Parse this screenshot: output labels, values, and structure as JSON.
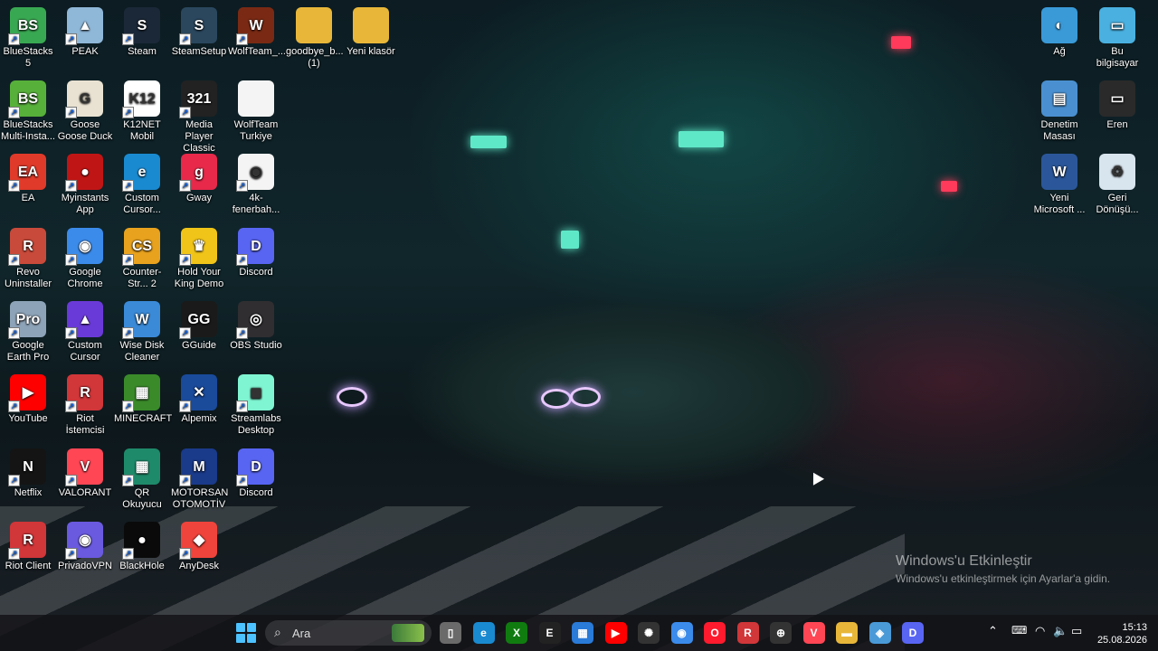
{
  "desktop_icons": [
    {
      "label": "BlueStacks 5",
      "icon": "bluestacks-icon",
      "color": "#39a852",
      "glyph": "BS"
    },
    {
      "label": "PEAK",
      "icon": "peak-icon",
      "color": "#8fb7d8",
      "glyph": "▲"
    },
    {
      "label": "Steam",
      "icon": "steam-icon",
      "color": "#1b2838",
      "glyph": "S"
    },
    {
      "label": "SteamSetup",
      "icon": "steam-setup-icon",
      "color": "#2a475e",
      "glyph": "S"
    },
    {
      "label": "WolfTeam_...",
      "icon": "wolfteam-icon",
      "color": "#7a2a14",
      "glyph": "W"
    },
    {
      "label": "goodbye_b... (1)",
      "icon": "folder-icon",
      "color": "#e8b73a",
      "glyph": ""
    },
    {
      "label": "Yeni klasör",
      "icon": "folder-icon",
      "color": "#e8b73a",
      "glyph": ""
    },
    {
      "label": "BlueStacks Multi-Insta...",
      "icon": "bluestacks-multi-icon",
      "color": "#57b03a",
      "glyph": "BS"
    },
    {
      "label": "Goose Goose Duck",
      "icon": "goose-icon",
      "color": "#e9e2d2",
      "glyph": "G"
    },
    {
      "label": "K12NET Mobil",
      "icon": "k12net-icon",
      "color": "#ffffff",
      "glyph": "K12"
    },
    {
      "label": "Media Player Classic",
      "icon": "media-player-icon",
      "color": "#222222",
      "glyph": "321"
    },
    {
      "label": "WolfTeam Turkiye",
      "icon": "file-icon",
      "color": "#f4f4f4",
      "glyph": ""
    },
    {
      "label": "EA",
      "icon": "ea-icon",
      "color": "#e03a2a",
      "glyph": "EA"
    },
    {
      "label": "Myinstants App",
      "icon": "myinstants-icon",
      "color": "#c01515",
      "glyph": "●"
    },
    {
      "label": "Custom Cursor...",
      "icon": "edge-icon",
      "color": "#1a8ad0",
      "glyph": "e"
    },
    {
      "label": "Gway",
      "icon": "gway-icon",
      "color": "#e8294a",
      "glyph": "g"
    },
    {
      "label": "4k-fenerbah...",
      "icon": "chrome-file-icon",
      "color": "#f4f4f4",
      "glyph": "◉"
    },
    {
      "label": "Revo Uninstaller",
      "icon": "revo-icon",
      "color": "#c84a3a",
      "glyph": "R"
    },
    {
      "label": "Google Chrome",
      "icon": "chrome-icon",
      "color": "#3b8beb",
      "glyph": "◉"
    },
    {
      "label": "Counter-Str... 2",
      "icon": "cs2-icon",
      "color": "#e8a21e",
      "glyph": "CS"
    },
    {
      "label": "Hold Your King Demo",
      "icon": "crown-icon",
      "color": "#f0c419",
      "glyph": "♛"
    },
    {
      "label": "Discord",
      "icon": "discord-icon",
      "color": "#5865f2",
      "glyph": "D"
    },
    {
      "label": "Google Earth Pro",
      "icon": "google-earth-icon",
      "color": "#8da3b8",
      "glyph": "Pro"
    },
    {
      "label": "Custom Cursor",
      "icon": "cursor-app-icon",
      "color": "#6a3ad8",
      "glyph": "▲"
    },
    {
      "label": "Wise Disk Cleaner",
      "icon": "wise-disk-icon",
      "color": "#3a8ad8",
      "glyph": "W"
    },
    {
      "label": "GGuide",
      "icon": "gguide-icon",
      "color": "#1a1a1a",
      "glyph": "GG"
    },
    {
      "label": "OBS Studio",
      "icon": "obs-icon",
      "color": "#302e31",
      "glyph": "◎"
    },
    {
      "label": "YouTube",
      "icon": "youtube-icon",
      "color": "#ff0000",
      "glyph": "▶"
    },
    {
      "label": "Riot İstemcisi",
      "icon": "riot-icon",
      "color": "#d13639",
      "glyph": "R"
    },
    {
      "label": "MINECRAFT",
      "icon": "minecraft-icon",
      "color": "#3a8a2a",
      "glyph": "▦"
    },
    {
      "label": "Alpemix",
      "icon": "alpemix-icon",
      "color": "#1a4a9a",
      "glyph": "✕"
    },
    {
      "label": "Streamlabs Desktop",
      "icon": "streamlabs-icon",
      "color": "#80f5d2",
      "glyph": "◼"
    },
    {
      "label": "Netflix",
      "icon": "netflix-icon",
      "color": "#141414",
      "glyph": "N"
    },
    {
      "label": "VALORANT",
      "icon": "valorant-icon",
      "color": "#ff4655",
      "glyph": "V"
    },
    {
      "label": "QR Okuyucu",
      "icon": "qr-icon",
      "color": "#1e8a6a",
      "glyph": "▦"
    },
    {
      "label": "MOTORSAN OTOMOTİV",
      "icon": "motorsan-icon",
      "color": "#1a3a8a",
      "glyph": "M"
    },
    {
      "label": "Discord",
      "icon": "discord-icon",
      "color": "#5865f2",
      "glyph": "D"
    },
    {
      "label": "Riot Client",
      "icon": "riot-client-icon",
      "color": "#d13639",
      "glyph": "R"
    },
    {
      "label": "PrivadoVPN",
      "icon": "privadovpn-icon",
      "color": "#6a5adf",
      "glyph": "◉"
    },
    {
      "label": "BlackHole",
      "icon": "blackhole-icon",
      "color": "#0a0a0a",
      "glyph": "●"
    },
    {
      "label": "AnyDesk",
      "icon": "anydesk-icon",
      "color": "#ef443b",
      "glyph": "◆"
    }
  ],
  "right_icons": [
    {
      "label": "Ağ",
      "icon": "network-icon",
      "color": "#3a9ad8",
      "glyph": "◐"
    },
    {
      "label": "Bu bilgisayar",
      "icon": "this-pc-icon",
      "color": "#4ab0e0",
      "glyph": "▭"
    },
    {
      "label": "Denetim Masası",
      "icon": "control-panel-icon",
      "color": "#4a90d0",
      "glyph": "▤"
    },
    {
      "label": "Eren",
      "icon": "user-folder-icon",
      "color": "#2a2a2a",
      "glyph": "▭"
    },
    {
      "label": "Yeni Microsoft ...",
      "icon": "word-doc-icon",
      "color": "#2b579a",
      "glyph": "W"
    },
    {
      "label": "Geri Dönüşü...",
      "icon": "recycle-bin-icon",
      "color": "#d8e4ee",
      "glyph": "♻"
    }
  ],
  "watermark": {
    "title": "Windows'u Etkinleştir",
    "subtitle": "Windows'u etkinleştirmek için Ayarlar'a gidin."
  },
  "taskbar": {
    "search_placeholder": "Ara",
    "apps": [
      {
        "name": "file-explorer-icon",
        "glyph": "▯",
        "color": "#6a6a6a"
      },
      {
        "name": "edge-icon",
        "glyph": "e",
        "color": "#1a8ad0"
      },
      {
        "name": "xbox-icon",
        "glyph": "X",
        "color": "#107c10"
      },
      {
        "name": "epic-games-icon",
        "glyph": "E",
        "color": "#222222"
      },
      {
        "name": "store-icon",
        "glyph": "▦",
        "color": "#2a7ad8"
      },
      {
        "name": "youtube-icon",
        "glyph": "▶",
        "color": "#ff0000"
      },
      {
        "name": "chatgpt-icon",
        "glyph": "✺",
        "color": "#333333"
      },
      {
        "name": "chrome-icon",
        "glyph": "◉",
        "color": "#3b8beb"
      },
      {
        "name": "opera-icon",
        "glyph": "O",
        "color": "#ff1b2d"
      },
      {
        "name": "riot-icon",
        "glyph": "R",
        "color": "#d13639"
      },
      {
        "name": "cs2-icon",
        "glyph": "⊕",
        "color": "#333333"
      },
      {
        "name": "valorant-icon",
        "glyph": "V",
        "color": "#ff4655"
      },
      {
        "name": "folder-icon",
        "glyph": "▬",
        "color": "#e8b73a"
      },
      {
        "name": "app-icon",
        "glyph": "◈",
        "color": "#4a9ad8"
      },
      {
        "name": "discord-icon",
        "glyph": "D",
        "color": "#5865f2"
      }
    ],
    "time": "15:13",
    "date": "25.08.2026"
  }
}
